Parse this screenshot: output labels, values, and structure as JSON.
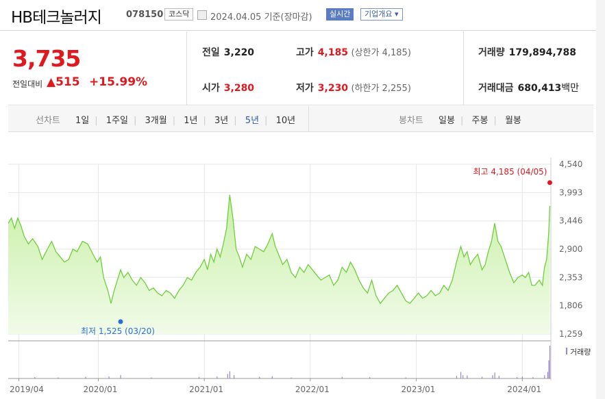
{
  "header": {
    "name": "HB테크놀러지",
    "code": "078150",
    "market": "코스닥",
    "date": "2024.04.05",
    "basis": "기준(장마감)",
    "realtime_label": "실시간",
    "company_info_label": "기업개요 ▾"
  },
  "summary": {
    "price": "3,735",
    "change_label": "전일대비",
    "change": "▲515",
    "change_pct": "+15.99%",
    "prev_label": "전일",
    "prev": "3,220",
    "open_label": "시가",
    "open": "3,280",
    "high_label": "고가",
    "high": "4,185",
    "upper_limit": "(상한가 4,185)",
    "low_label": "저가",
    "low": "3,230",
    "lower_limit": "(하한가 2,255)",
    "volume_label": "거래량",
    "volume": "179,894,788",
    "value_label": "거래대금",
    "value": "680,413",
    "value_unit": "백만"
  },
  "tabs": {
    "line_label": "선차트",
    "line": [
      "1일",
      "1주일",
      "3개월",
      "1년",
      "3년",
      "5년",
      "10년"
    ],
    "line_active": "5년",
    "candle_label": "봉차트",
    "candle": [
      "일봉",
      "주봉",
      "월봉"
    ]
  },
  "colors": {
    "accent_red": "#e0191f",
    "line_green": "#6fce3a",
    "area_fill_top": "#c8f0a6",
    "area_fill_bottom": "#f1fbe9",
    "min_blue": "#2c6ed1",
    "volume_purple": "#9a86c8",
    "tab_active_blue": "#2c5bbf"
  },
  "chart_data": {
    "type": "area",
    "y_ticks": [
      "4,540",
      "3,993",
      "3,446",
      "2,900",
      "2,353",
      "1,806",
      "1,259"
    ],
    "ylim": [
      1259,
      4540
    ],
    "x_ticks": [
      "2019/04",
      "2020/01",
      "2021/01",
      "2022/01",
      "2023/01",
      "2024/01"
    ],
    "x_tick_pos": [
      2019.25,
      2020.0,
      2021.0,
      2022.0,
      2023.0,
      2024.0
    ],
    "xlim": [
      2019.15,
      2024.27
    ],
    "series": [
      {
        "values": [
          [
            2019.15,
            3400
          ],
          [
            2019.18,
            3500
          ],
          [
            2019.21,
            3300
          ],
          [
            2019.24,
            3500
          ],
          [
            2019.27,
            3350
          ],
          [
            2019.3,
            3150
          ],
          [
            2019.34,
            3000
          ],
          [
            2019.38,
            3100
          ],
          [
            2019.43,
            2950
          ],
          [
            2019.47,
            2700
          ],
          [
            2019.52,
            2900
          ],
          [
            2019.56,
            3050
          ],
          [
            2019.6,
            2850
          ],
          [
            2019.64,
            2750
          ],
          [
            2019.68,
            2650
          ],
          [
            2019.72,
            2700
          ],
          [
            2019.76,
            2900
          ],
          [
            2019.8,
            2850
          ],
          [
            2019.85,
            3050
          ],
          [
            2019.9,
            3000
          ],
          [
            2019.95,
            2800
          ],
          [
            2019.99,
            2650
          ],
          [
            2020.02,
            2750
          ],
          [
            2020.05,
            2350
          ],
          [
            2020.09,
            2100
          ],
          [
            2020.12,
            1850
          ],
          [
            2020.15,
            2100
          ],
          [
            2020.18,
            2300
          ],
          [
            2020.21,
            2500
          ],
          [
            2020.24,
            2350
          ],
          [
            2020.28,
            2450
          ],
          [
            2020.32,
            2300
          ],
          [
            2020.36,
            2200
          ],
          [
            2020.4,
            2350
          ],
          [
            2020.44,
            2250
          ],
          [
            2020.48,
            2100
          ],
          [
            2020.52,
            2150
          ],
          [
            2020.56,
            2050
          ],
          [
            2020.6,
            2000
          ],
          [
            2020.64,
            2100
          ],
          [
            2020.68,
            2050
          ],
          [
            2020.72,
            1950
          ],
          [
            2020.76,
            2100
          ],
          [
            2020.8,
            2200
          ],
          [
            2020.84,
            2350
          ],
          [
            2020.88,
            2300
          ],
          [
            2020.92,
            2450
          ],
          [
            2020.96,
            2550
          ],
          [
            2021.0,
            2700
          ],
          [
            2021.03,
            2500
          ],
          [
            2021.06,
            2800
          ],
          [
            2021.09,
            2650
          ],
          [
            2021.12,
            2900
          ],
          [
            2021.15,
            2750
          ],
          [
            2021.18,
            3000
          ],
          [
            2021.21,
            3300
          ],
          [
            2021.24,
            3950
          ],
          [
            2021.27,
            3500
          ],
          [
            2021.3,
            2900
          ],
          [
            2021.33,
            2750
          ],
          [
            2021.36,
            2550
          ],
          [
            2021.4,
            2800
          ],
          [
            2021.44,
            2700
          ],
          [
            2021.48,
            2950
          ],
          [
            2021.52,
            2900
          ],
          [
            2021.56,
            2850
          ],
          [
            2021.6,
            3000
          ],
          [
            2021.64,
            3200
          ],
          [
            2021.67,
            2950
          ],
          [
            2021.7,
            2800
          ],
          [
            2021.74,
            2600
          ],
          [
            2021.78,
            2700
          ],
          [
            2021.82,
            2450
          ],
          [
            2021.86,
            2350
          ],
          [
            2021.9,
            2550
          ],
          [
            2021.94,
            2450
          ],
          [
            2021.98,
            2600
          ],
          [
            2022.02,
            2500
          ],
          [
            2022.06,
            2400
          ],
          [
            2022.1,
            2300
          ],
          [
            2022.14,
            2350
          ],
          [
            2022.18,
            2400
          ],
          [
            2022.22,
            2200
          ],
          [
            2022.26,
            2300
          ],
          [
            2022.3,
            2550
          ],
          [
            2022.34,
            2450
          ],
          [
            2022.38,
            2650
          ],
          [
            2022.42,
            2500
          ],
          [
            2022.46,
            2300
          ],
          [
            2022.5,
            2150
          ],
          [
            2022.54,
            2050
          ],
          [
            2022.58,
            2300
          ],
          [
            2022.62,
            2000
          ],
          [
            2022.66,
            1850
          ],
          [
            2022.7,
            1950
          ],
          [
            2022.74,
            2050
          ],
          [
            2022.78,
            2100
          ],
          [
            2022.82,
            2200
          ],
          [
            2022.86,
            2050
          ],
          [
            2022.9,
            1900
          ],
          [
            2022.94,
            1850
          ],
          [
            2022.98,
            1950
          ],
          [
            2023.02,
            2050
          ],
          [
            2023.06,
            1950
          ],
          [
            2023.1,
            2000
          ],
          [
            2023.14,
            2100
          ],
          [
            2023.18,
            2000
          ],
          [
            2023.22,
            2050
          ],
          [
            2023.26,
            2200
          ],
          [
            2023.3,
            2100
          ],
          [
            2023.34,
            2300
          ],
          [
            2023.38,
            2650
          ],
          [
            2023.42,
            2950
          ],
          [
            2023.45,
            2750
          ],
          [
            2023.48,
            2850
          ],
          [
            2023.51,
            2600
          ],
          [
            2023.54,
            2700
          ],
          [
            2023.58,
            2800
          ],
          [
            2023.62,
            2500
          ],
          [
            2023.65,
            2600
          ],
          [
            2023.68,
            2850
          ],
          [
            2023.71,
            3050
          ],
          [
            2023.74,
            3400
          ],
          [
            2023.77,
            3050
          ],
          [
            2023.8,
            2950
          ],
          [
            2023.84,
            2700
          ],
          [
            2023.88,
            2450
          ],
          [
            2023.92,
            2250
          ],
          [
            2023.96,
            2350
          ],
          [
            2024.0,
            2400
          ],
          [
            2024.03,
            2350
          ],
          [
            2024.06,
            2450
          ],
          [
            2024.09,
            2200
          ],
          [
            2024.12,
            2200
          ],
          [
            2024.16,
            2300
          ],
          [
            2024.19,
            2200
          ],
          [
            2024.21,
            2550
          ],
          [
            2024.23,
            2700
          ],
          [
            2024.25,
            3220
          ],
          [
            2024.26,
            3735
          ]
        ]
      }
    ],
    "max_point": {
      "x": 2024.26,
      "y": 4185,
      "label": "최고 4,185 (04/05)"
    },
    "min_point": {
      "x": 2020.21,
      "y": 1525,
      "label": "최저 1,525 (03/20)"
    },
    "volume_label": "거래량",
    "volume_bars": [
      [
        2019.4,
        0.04
      ],
      [
        2019.62,
        0.03
      ],
      [
        2019.88,
        0.05
      ],
      [
        2020.1,
        0.06
      ],
      [
        2020.21,
        0.1
      ],
      [
        2020.5,
        0.03
      ],
      [
        2020.95,
        0.05
      ],
      [
        2021.12,
        0.06
      ],
      [
        2021.22,
        0.14
      ],
      [
        2021.24,
        0.22
      ],
      [
        2021.28,
        0.1
      ],
      [
        2021.52,
        0.05
      ],
      [
        2021.64,
        0.07
      ],
      [
        2021.82,
        0.03
      ],
      [
        2022.3,
        0.05
      ],
      [
        2022.56,
        0.04
      ],
      [
        2022.9,
        0.03
      ],
      [
        2023.38,
        0.08
      ],
      [
        2023.42,
        0.2
      ],
      [
        2023.44,
        0.1
      ],
      [
        2023.48,
        0.09
      ],
      [
        2023.62,
        0.05
      ],
      [
        2023.72,
        0.1
      ],
      [
        2023.74,
        0.18
      ],
      [
        2023.78,
        0.08
      ],
      [
        2023.95,
        0.04
      ],
      [
        2024.0,
        0.06
      ],
      [
        2024.1,
        0.04
      ],
      [
        2024.21,
        0.1
      ],
      [
        2024.24,
        0.2
      ],
      [
        2024.25,
        0.55
      ],
      [
        2024.26,
        1.0
      ]
    ]
  }
}
